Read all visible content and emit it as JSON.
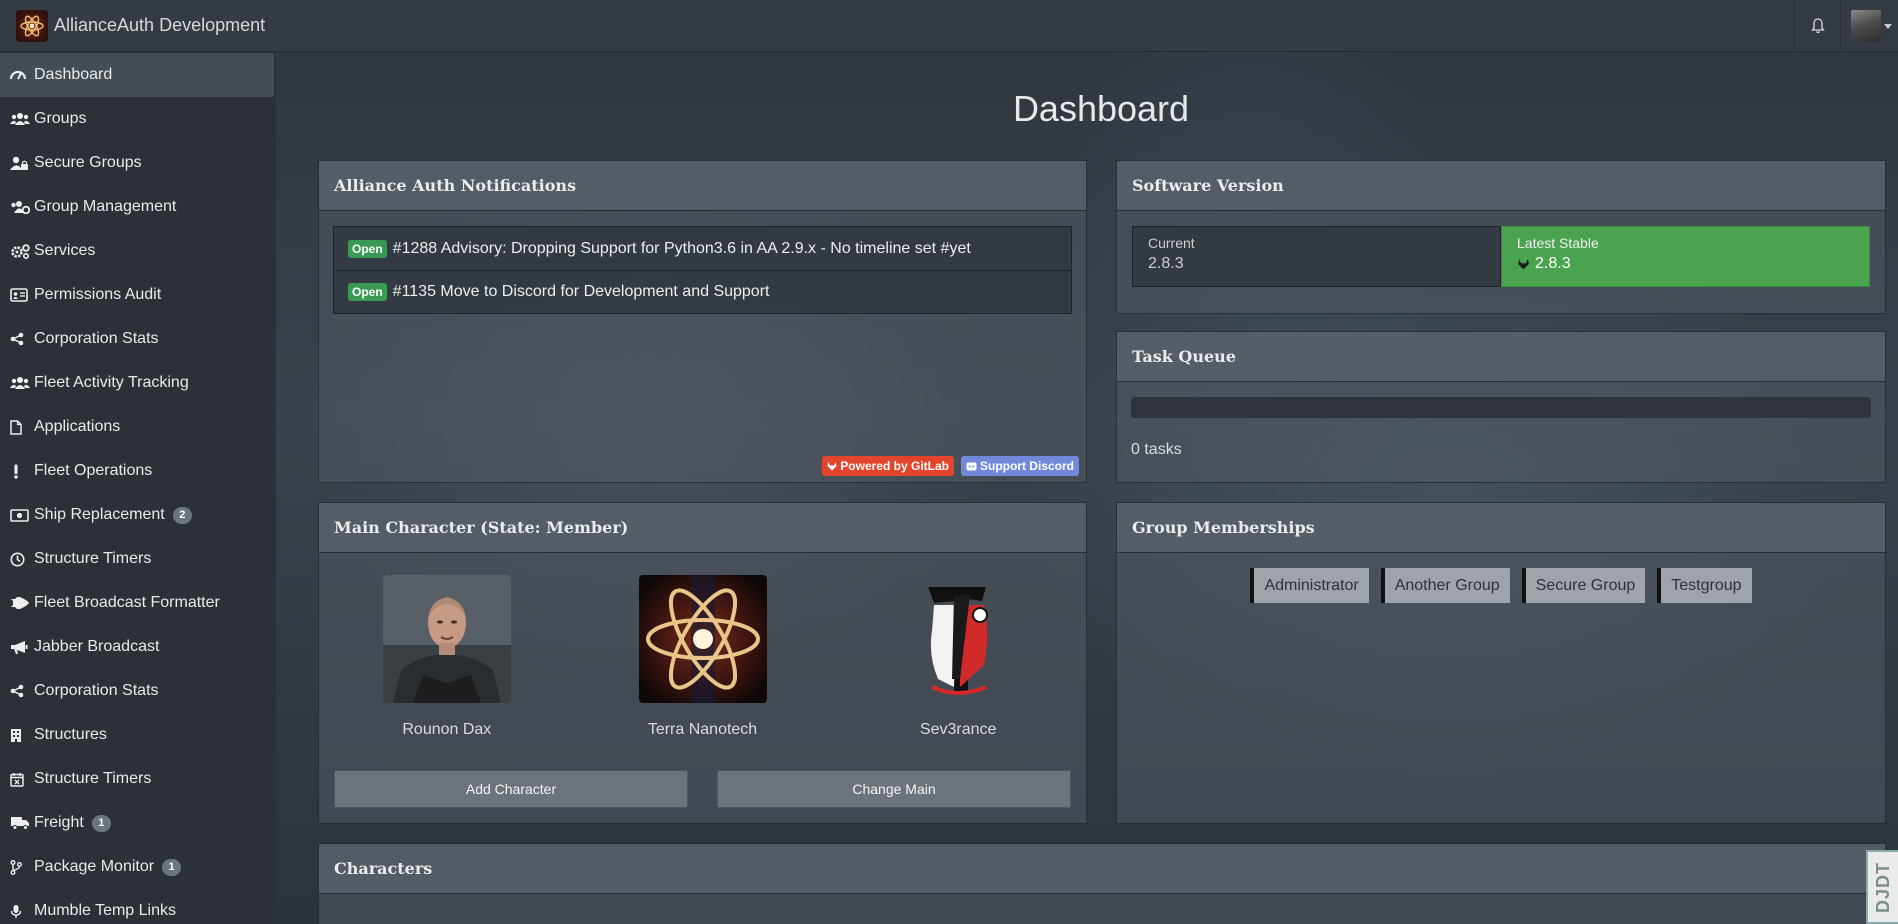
{
  "app": {
    "title": "AllianceAuth Development"
  },
  "sidebar": {
    "items": [
      {
        "label": "Dashboard",
        "icon": "dashboard-icon",
        "active": true
      },
      {
        "label": "Groups",
        "icon": "users-icon"
      },
      {
        "label": "Secure Groups",
        "icon": "user-lock-icon"
      },
      {
        "label": "Group Management",
        "icon": "users-cog-icon"
      },
      {
        "label": "Services",
        "icon": "cogs-icon"
      },
      {
        "label": "Permissions Audit",
        "icon": "id-card-icon"
      },
      {
        "label": "Corporation Stats",
        "icon": "share-icon"
      },
      {
        "label": "Fleet Activity Tracking",
        "icon": "users-icon"
      },
      {
        "label": "Applications",
        "icon": "file-icon"
      },
      {
        "label": "Fleet Operations",
        "icon": "exclamation-icon"
      },
      {
        "label": "Ship Replacement",
        "icon": "money-icon",
        "badge": "2"
      },
      {
        "label": "Structure Timers",
        "icon": "clock-icon"
      },
      {
        "label": "Fleet Broadcast Formatter",
        "icon": "space-shuttle-icon"
      },
      {
        "label": "Jabber Broadcast",
        "icon": "bullhorn-icon"
      },
      {
        "label": "Corporation Stats",
        "icon": "share-icon"
      },
      {
        "label": "Structures",
        "icon": "building-icon"
      },
      {
        "label": "Structure Timers",
        "icon": "calendar-icon"
      },
      {
        "label": "Freight",
        "icon": "truck-icon",
        "badge": "1"
      },
      {
        "label": "Package Monitor",
        "icon": "code-branch-icon",
        "badge": "1"
      },
      {
        "label": "Mumble Temp Links",
        "icon": "microphone-icon"
      }
    ]
  },
  "main": {
    "title": "Dashboard",
    "notifications": {
      "heading": "Alliance Auth Notifications",
      "items": [
        {
          "status": "Open",
          "text": "#1288 Advisory: Dropping Support for Python3.6 in AA 2.9.x - No timeline set #yet"
        },
        {
          "status": "Open",
          "text": "#1135 Move to Discord for Development and Support"
        }
      ],
      "gitlab_label": "Powered by GitLab",
      "discord_label": "Support Discord"
    },
    "software_version": {
      "heading": "Software Version",
      "current_label": "Current",
      "current_value": "2.8.3",
      "latest_label": "Latest Stable",
      "latest_value": "2.8.3"
    },
    "task_queue": {
      "heading": "Task Queue",
      "count_text": "0 tasks",
      "progress": 0
    },
    "main_character": {
      "heading": "Main Character (State: Member)",
      "character": "Rounon Dax",
      "corporation": "Terra Nanotech",
      "alliance": "Sev3rance",
      "add_button": "Add Character",
      "change_button": "Change Main"
    },
    "group_memberships": {
      "heading": "Group Memberships",
      "groups": [
        "Administrator",
        "Another Group",
        "Secure Group",
        "Testgroup"
      ]
    },
    "characters": {
      "heading": "Characters"
    }
  },
  "debug_toolbar": {
    "label": "DJDT"
  },
  "colors": {
    "success": "#4aa34f",
    "open_badge": "#3a9a55",
    "gitlab": "#e2452b",
    "discord": "#7289da"
  }
}
